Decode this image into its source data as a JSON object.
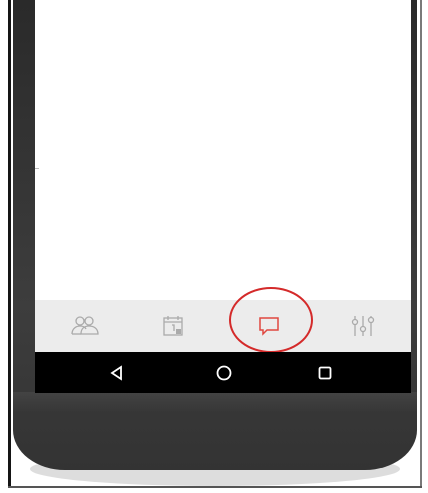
{
  "device": {
    "body_color": "#333333",
    "screen_color": "#ffffff"
  },
  "tab_bar": {
    "background": "#ececec",
    "icon_color": "#aaaaaa",
    "active_color": "#e0473f",
    "tabs": [
      {
        "icon": "people-icon",
        "active": false
      },
      {
        "icon": "calendar-icon",
        "active": false
      },
      {
        "icon": "chat-icon",
        "active": true
      },
      {
        "icon": "sliders-icon",
        "active": false
      }
    ]
  },
  "highlight": {
    "color": "#d42a2a",
    "target": "chat-icon"
  },
  "system_nav": {
    "background": "#000000",
    "icon_color": "#ffffff",
    "buttons": [
      "back-icon",
      "home-icon",
      "recents-icon"
    ]
  }
}
